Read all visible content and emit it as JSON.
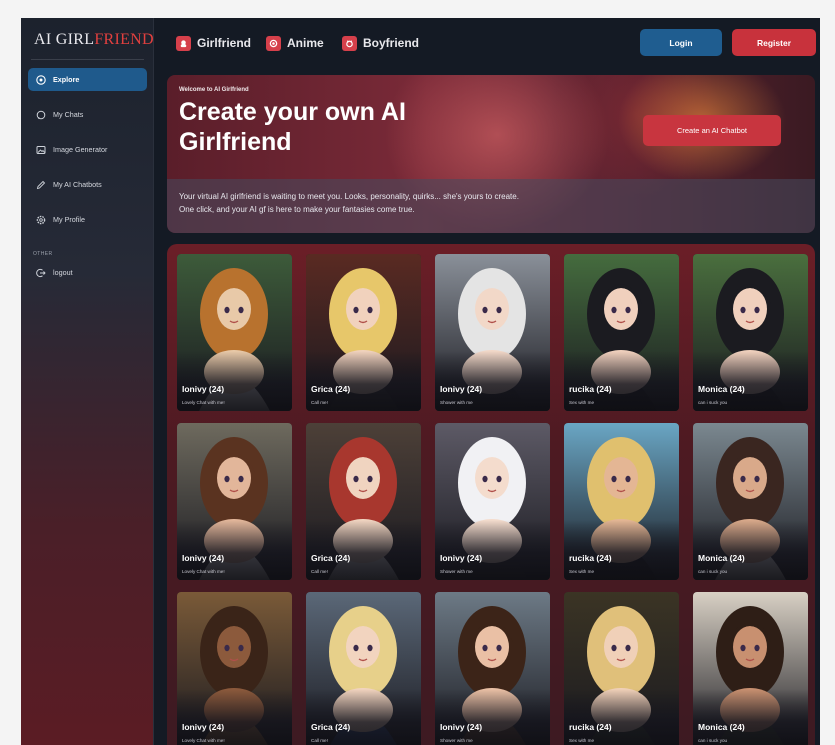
{
  "logo": {
    "part1": "AI GIRL",
    "part2": "FRIEND"
  },
  "sidebar": {
    "items": [
      {
        "label": "Explore",
        "icon": "compass-icon"
      },
      {
        "label": "My Chats",
        "icon": "chat-icon"
      },
      {
        "label": "Image Generator",
        "icon": "image-icon"
      },
      {
        "label": "My AI Chatbots",
        "icon": "pen-icon"
      },
      {
        "label": "My Profile",
        "icon": "settings-icon"
      }
    ],
    "other_label": "OTHER",
    "logout_label": "logout"
  },
  "topbar": {
    "categories": [
      {
        "label": "Girlfriend",
        "icon": "female-icon"
      },
      {
        "label": "Anime",
        "icon": "anime-icon"
      },
      {
        "label": "Boyfriend",
        "icon": "male-icon"
      }
    ],
    "login_label": "Login",
    "register_label": "Register"
  },
  "hero": {
    "welcome": "Welcome to AI Girlfriend",
    "title": "Create your own AI Girlfriend",
    "cta": "Create an AI Chatbot",
    "desc_line1": "Your virtual AI girlfriend is waiting to meet you. Looks, personality, quirks... she's yours to create.",
    "desc_line2": "One click, and your AI gf is here to make your fantasies come true."
  },
  "cards": [
    {
      "name": "Ionivy (24)",
      "desc": "Lovely Chat with me!"
    },
    {
      "name": "Grica (24)",
      "desc": "Call me!"
    },
    {
      "name": "Ionivy (24)",
      "desc": "Shower with me"
    },
    {
      "name": "rucika (24)",
      "desc": "Sex with me"
    },
    {
      "name": "Monica (24)",
      "desc": "can i suck you"
    },
    {
      "name": "Ionivy (24)",
      "desc": "Lovely Chat with me!"
    },
    {
      "name": "Grica (24)",
      "desc": "Call me!"
    },
    {
      "name": "Ionivy (24)",
      "desc": "Shower with me"
    },
    {
      "name": "rucika (24)",
      "desc": "Sex with me"
    },
    {
      "name": "Monica (24)",
      "desc": "can i suck you"
    },
    {
      "name": "Ionivy (24)",
      "desc": "Lovely Chat with me!"
    },
    {
      "name": "Grica (24)",
      "desc": "Call me!"
    },
    {
      "name": "Ionivy (24)",
      "desc": "Shower with me"
    },
    {
      "name": "rucika (24)",
      "desc": "Sex with me"
    },
    {
      "name": "Monica (24)",
      "desc": "can i suck you"
    }
  ],
  "colors": {
    "accent_blue": "#1f5d90",
    "accent_red": "#c8323c",
    "background": "#141a24"
  }
}
